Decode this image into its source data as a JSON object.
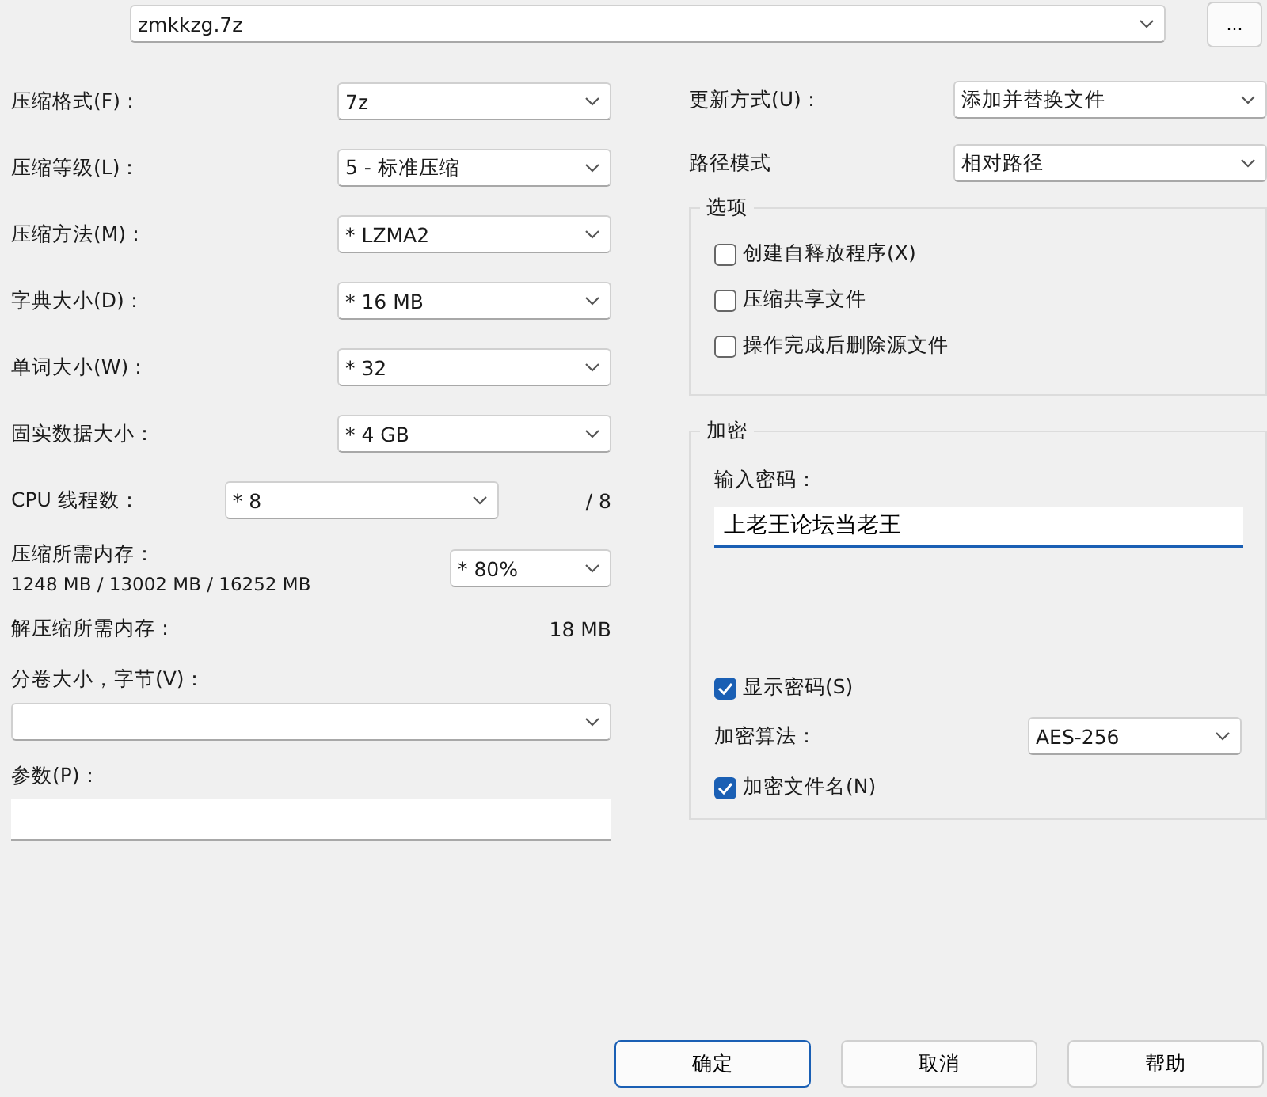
{
  "archive": {
    "value": "zmkkzg.7z",
    "browse_button": "..."
  },
  "settings": [
    {
      "label": "压缩格式(F)：",
      "value": "7z"
    },
    {
      "label": "压缩等级(L)：",
      "value": "5 - 标准压缩"
    },
    {
      "label": "压缩方法(M)：",
      "value": "* LZMA2"
    },
    {
      "label": "字典大小(D)：",
      "value": "* 16 MB"
    },
    {
      "label": "单词大小(W)：",
      "value": "* 32"
    },
    {
      "label": "固实数据大小：",
      "value": "* 4 GB"
    }
  ],
  "cpu_threads": {
    "label": "CPU 线程数：",
    "value": "* 8",
    "max": "/ 8"
  },
  "memory": {
    "label": "压缩所需内存：",
    "usage": "1248 MB / 13002 MB / 16252 MB",
    "value": "* 80%"
  },
  "decompress_memory": {
    "label": "解压缩所需内存：",
    "value": "18 MB"
  },
  "volume_size": {
    "label": "分卷大小，字节(V)："
  },
  "parameters": {
    "label": "参数(P)："
  },
  "update_mode": {
    "label": "更新方式(U)：",
    "value": "添加并替换文件"
  },
  "path_mode": {
    "label": "路径模式",
    "value": "相对路径"
  },
  "options": {
    "title": "选项",
    "items": [
      {
        "label": "创建自释放程序(X)",
        "checked": false
      },
      {
        "label": "压缩共享文件",
        "checked": false
      },
      {
        "label": "操作完成后删除源文件",
        "checked": false
      }
    ]
  },
  "encryption": {
    "title": "加密",
    "password_label": "输入密码：",
    "password": "上老王论坛当老王",
    "show_password": {
      "label": "显示密码(S)",
      "checked": true
    },
    "method_label": "加密算法：",
    "method": "AES-256",
    "encrypt_names": {
      "label": "加密文件名(N)",
      "checked": true
    }
  },
  "buttons": [
    {
      "label": "确定",
      "default": true
    },
    {
      "label": "取消",
      "default": false
    },
    {
      "label": "帮助",
      "default": false
    }
  ]
}
